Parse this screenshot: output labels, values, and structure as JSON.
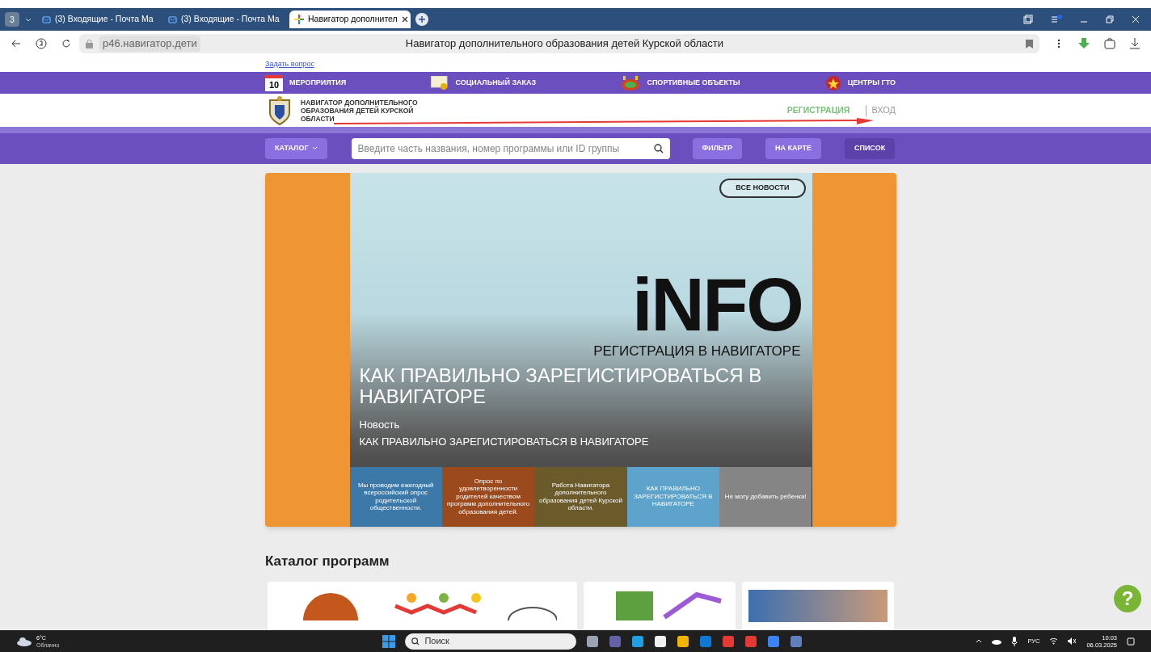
{
  "browser": {
    "tab_count": "3",
    "tabs": [
      {
        "label": "(3) Входящие - Почта Ма",
        "selected": false
      },
      {
        "label": "(3) Входящие - Почта Ма",
        "selected": false
      },
      {
        "label": "Навигатор дополнител",
        "selected": true
      }
    ],
    "address": "р46.навигатор.дети",
    "page_title": "Навигатор дополнительного образования детей Курской области"
  },
  "page": {
    "ask_link": "Задать вопрос",
    "calendar_day": "10",
    "top_nav": [
      {
        "label": "МЕРОПРИЯТИЯ"
      },
      {
        "label": "СОЦИАЛЬНЫЙ ЗАКАЗ"
      },
      {
        "label": "СПОРТИВНЫЕ ОБЪЕКТЫ"
      },
      {
        "label": "ЦЕНТРЫ ГТО"
      }
    ],
    "logo_text": "НАВИГАТОР ДОПОЛНИТЕЛЬНОГО ОБРАЗОВАНИЯ ДЕТЕЙ КУРСКОЙ ОБЛАСТИ",
    "registration": "РЕГИСТРАЦИЯ",
    "login": "ВХОД",
    "catalog_button": "КАТАЛОГ",
    "search": {
      "placeholder": "Введите часть названия, номер программы или ID группы"
    },
    "buttons": [
      {
        "label": "ФИЛЬТР",
        "kind": "filled"
      },
      {
        "label": "НА КАРТЕ",
        "kind": "filled"
      },
      {
        "label": "СПИСОК",
        "kind": "plain"
      }
    ],
    "banner": {
      "all_news": "ВСЕ НОВОСТИ",
      "logo_word": "iNFO",
      "logo_caption": "РЕГИСТРАЦИЯ В НАВИГАТОРЕ",
      "headline": "КАК ПРАВИЛЬНО ЗАРЕГИСТИРОВАТЬСЯ В НАВИГАТОРЕ",
      "tag": "Новость",
      "subtitle": "КАК ПРАВИЛЬНО ЗАРЕГИСТИРОВАТЬСЯ В НАВИГАТОРЕ",
      "thumbnails": [
        {
          "text": "Мы проводим ежегодный всероссийский опрос родительской общественности."
        },
        {
          "text": "Опрос по удовлетворенности родителей качеством программ дополнительного образования детей."
        },
        {
          "text": "Работа Навигатора дополнительного образования детей Курской области."
        },
        {
          "text": "КАК ПРАВИЛЬНО ЗАРЕГИСТИРОВАТЬСЯ В НАВИГАТОРЕ"
        },
        {
          "text": "Не могу добавить ребенка!"
        }
      ]
    },
    "catalog_title": "Каталог программ",
    "help": "?"
  },
  "taskbar": {
    "temperature": "6°C",
    "weather": "Облачно",
    "search": "Поиск",
    "language": "РУС",
    "time": "10:03",
    "date": "06.03.2025"
  }
}
